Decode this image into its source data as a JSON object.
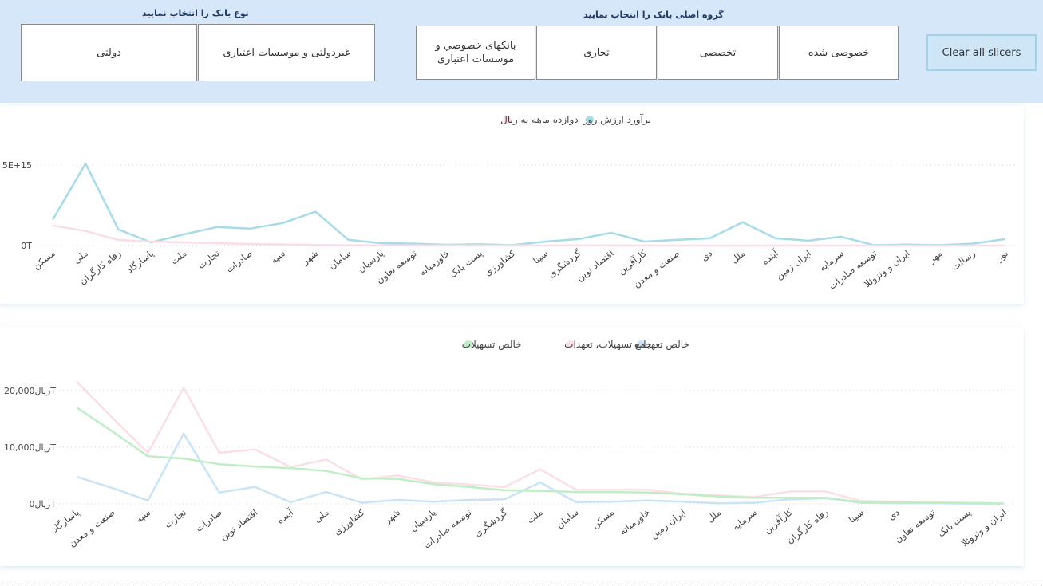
{
  "slicers": {
    "bank_type": {
      "title": "نوع بانک را انتخاب نمایید",
      "options": [
        "دولتی",
        "غیردولتی و موسسات اعتباری"
      ]
    },
    "bank_group": {
      "title": "گروه اصلی بانک را انتخاب نمایید",
      "options": [
        "بانکهای خصوصي و موسسات اعتباری",
        "تجاری",
        "تخصصی",
        "خصوصی شده"
      ]
    },
    "clear_label": "Clear all slicers"
  },
  "chart_data": [
    {
      "type": "line",
      "legend_position": "top-center",
      "grid": true,
      "legend": [
        "برآورد ارزش روز",
        "دوازده ماهه به ریال"
      ],
      "y_tick_labels": [
        "0T",
        "5E+15"
      ],
      "y_ticks": [
        0,
        5000000000000000
      ],
      "ylim": [
        0,
        5600000000000000
      ],
      "categories": [
        "مسکن",
        "ملی",
        "رفاه کارگران",
        "پاسارگاد",
        "ملت",
        "تجارت",
        "صادرات",
        "سپه",
        "شهر",
        "سامان",
        "پارسیان",
        "توسعه تعاون",
        "خاورمیانه",
        "پست بانک",
        "کشاورزی",
        "سینا",
        "گردشگری",
        "اقتصاد نوین",
        "کارآفرین",
        "صنعت و معدن",
        "دی",
        "ملل",
        "آینده",
        "ایران زمین",
        "سرمایه",
        "توسعه صادرات",
        "ایران و ونزوئلا",
        "مهر",
        "رسالت",
        "نور"
      ],
      "series": [
        {
          "name": "برآورد ارزش روز",
          "color": "#a6dbe8",
          "values": [
            1600000000000000.0,
            5100000000000000.0,
            1000000000000000.0,
            200000000000000.0,
            700000000000000.0,
            1150000000000000.0,
            1050000000000000.0,
            1400000000000000.0,
            2100000000000000.0,
            350000000000000.0,
            150000000000000.0,
            120000000000000.0,
            50000000000000.0,
            80000000000000.0,
            30000000000000.0,
            250000000000000.0,
            400000000000000.0,
            800000000000000.0,
            250000000000000.0,
            350000000000000.0,
            450000000000000.0,
            1450000000000000.0,
            450000000000000.0,
            300000000000000.0,
            550000000000000.0,
            30000000000000.0,
            60000000000000.0,
            30000000000000.0,
            120000000000000.0,
            400000000000000.0
          ]
        },
        {
          "name": "دوازده ماهه به ریال",
          "color": "#fadde6",
          "values": [
            1250000000000000.0,
            900000000000000.0,
            350000000000000.0,
            250000000000000.0,
            200000000000000.0,
            150000000000000.0,
            100000000000000.0,
            70000000000000.0,
            40000000000000.0,
            20000000000000.0,
            10000000000000.0,
            10000000000000.0,
            5000000000000.0,
            5000000000000.0,
            3000000000000.0,
            3000000000000.0,
            3000000000000.0,
            3000000000000.0,
            2000000000000.0,
            2000000000000.0,
            2000000000000.0,
            2000000000000.0,
            2000000000000.0,
            1000000000000.0,
            1000000000000.0,
            1000000000000.0,
            1000000000000.0,
            1000000000000.0,
            1000000000000.0,
            1000000000000.0
          ]
        }
      ]
    },
    {
      "type": "line",
      "legend_position": "top-center",
      "grid": true,
      "legend": [
        "خالص تعهدات",
        "جمع تسهیلات، تعهدات",
        "خالص تسهیلات"
      ],
      "y_tick_labels": [
        "ریال0T",
        "ریال10,000T",
        "ریال20,000T"
      ],
      "y_ticks": [
        0,
        10000,
        20000
      ],
      "ylim": [
        0,
        22500
      ],
      "categories": [
        "پاسارگاد",
        "صنعت و معدن",
        "سپه",
        "تجارت",
        "صادرات",
        "اقتصاد نوین",
        "آینده",
        "ملی",
        "کشاورزی",
        "شهر",
        "پارسیان",
        "توسعه صادرات",
        "گردشگری",
        "ملت",
        "سامان",
        "مسکن",
        "خاورمیانه",
        "ایران زمین",
        "ملل",
        "سرمایه",
        "کارآفرین",
        "رفاه کارگران",
        "سینا",
        "دی",
        "توسعه تعاون",
        "پست بانک",
        "ایران و ونزوئلا"
      ],
      "series": [
        {
          "name": "خالص تعهدات",
          "color": "#c9e3f7",
          "values": [
            4800,
            2800,
            600,
            12400,
            2000,
            3000,
            300,
            2100,
            200,
            700,
            400,
            700,
            800,
            3800,
            300,
            400,
            600,
            400,
            100,
            200,
            800,
            1000,
            200,
            100,
            100,
            50,
            50
          ]
        },
        {
          "name": "جمع تسهیلات، تعهدات",
          "color": "#fbdfe6",
          "values": [
            21600,
            15200,
            9000,
            20500,
            9000,
            9600,
            6500,
            7800,
            4300,
            5000,
            3800,
            3400,
            3000,
            6100,
            2500,
            2500,
            2500,
            1800,
            1500,
            1200,
            2200,
            2200,
            500,
            400,
            300,
            200,
            100
          ]
        },
        {
          "name": "خالص تسهیلات",
          "color": "#bfeec4",
          "values": [
            17000,
            12800,
            8400,
            8000,
            7000,
            6600,
            6300,
            5800,
            4500,
            4400,
            3500,
            3000,
            2400,
            2300,
            2100,
            2100,
            2000,
            1700,
            1300,
            1100,
            1100,
            1100,
            300,
            300,
            200,
            150,
            50
          ]
        }
      ]
    }
  ]
}
